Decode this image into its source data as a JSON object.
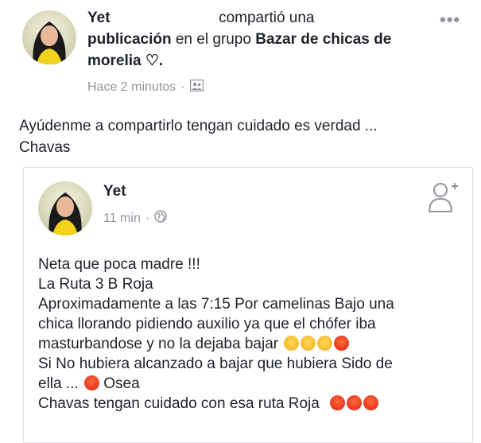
{
  "shared_post": {
    "author": "Yet",
    "action": "compartió una",
    "object": "publicación",
    "connector": "en el grupo",
    "group": "Bazar de chicas de morelia ♡.",
    "time": "Hace 2 minutos",
    "caption_line1": "Ayúdenme a compartirlo tengan cuidado es verdad ...",
    "caption_line2": "Chavas"
  },
  "original_post": {
    "author": "Yet",
    "time": "11 min",
    "lines": [
      "Neta que poca madre !!!",
      "La Ruta 3 B Roja",
      "Aproximadamente a las 7:15 Por camelinas Bajo una",
      "chica llorando pidiendo auxilio ya que el chófer iba",
      "masturbandose y no la dejaba bajar",
      "Si No hubiera alcanzado a bajar que hubiera Sido de",
      "ella ...",
      "Osea",
      "Chavas tengan cuidado con esa ruta Roja"
    ]
  },
  "icons": {
    "more": "more-dots-icon",
    "audience_group": "group-audience-icon",
    "audience_public": "globe-icon",
    "add_friend": "add-friend-icon",
    "emoji_triumph": "triumph-emoji-icon",
    "emoji_angry": "angry-emoji-icon"
  },
  "colors": {
    "text": "#1d2129",
    "meta": "#90949c",
    "border": "#dddfe2"
  }
}
